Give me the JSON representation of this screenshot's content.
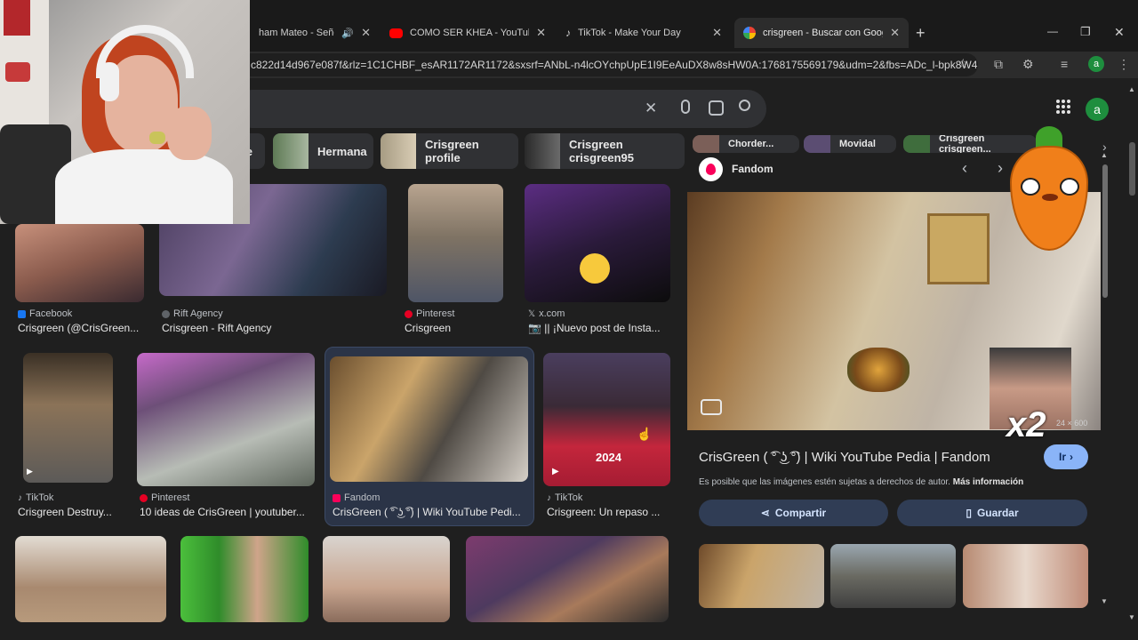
{
  "tabs": [
    {
      "title": "ham Mateo - Señorita",
      "favicon_color": "#3c3c3c",
      "has_audio": true
    },
    {
      "title": "COMO SER KHEA - YouTube",
      "favicon_color": "#ff0000"
    },
    {
      "title": "TikTok - Make Your Day",
      "favicon_color": "#111111"
    },
    {
      "title": "crisgreen - Buscar con Google",
      "favicon_color": "#4285f4",
      "active": true
    }
  ],
  "new_tab": "+",
  "window_controls": {
    "minimize": "—",
    "restore": "❐",
    "close": "✕"
  },
  "url": "c822d14d967e087f&rlz=1C1CHBF_esAR1172AR1172&sxsrf=ANbL-n4lcOYchpUpE1I9EeAuDX8w8sHW0A:1768175569179&udm=2&fbs=ADc_l-bpk8W4...",
  "profile_initial": "a",
  "chips": [
    {
      "label": "e"
    },
    {
      "label": "Hermana"
    },
    {
      "label": "Crisgreen profile"
    },
    {
      "label": "Crisgreen crisgreen95"
    },
    {
      "label": "Chorder..."
    },
    {
      "label": "Movidal"
    },
    {
      "label": "Crisgreen crisgreen..."
    }
  ],
  "results_row1": [
    {
      "source": "Facebook",
      "source_color": "#1877f2",
      "caption": "Crisgreen (@CrisGreen..."
    },
    {
      "source": "Rift Agency",
      "source_color": "#5f6368",
      "caption": "Crisgreen - Rift Agency"
    },
    {
      "source": "Pinterest",
      "source_color": "#e60023",
      "caption": "Crisgreen"
    },
    {
      "source": "x.com",
      "source_color": "#444444",
      "caption": "📷 || ¡Nuevo post de Insta..."
    }
  ],
  "results_row2": [
    {
      "source": "TikTok",
      "source_color": "#111111",
      "caption": "Crisgreen Destruy..."
    },
    {
      "source": "Pinterest",
      "source_color": "#e60023",
      "caption": "10 ideas de CrisGreen | youtuber..."
    },
    {
      "source": "Fandom",
      "source_color": "#fa005a",
      "caption": "CrisGreen ( ͡° ͜ʖ ͡°) | Wiki YouTube Pedi..."
    },
    {
      "source": "TikTok",
      "source_color": "#111111",
      "caption": "Crisgreen: Un repaso ..."
    }
  ],
  "year_overlay": "2024",
  "panel": {
    "source": "Fandom",
    "title": "CrisGreen ( ͡° ͜ʖ ͡°) | Wiki YouTube Pedia | Fandom",
    "visit": "Ir",
    "dims": "24 × 600",
    "copyright": "Es posible que las imágenes estén sujetas a derechos de autor.",
    "more_info": "Más información",
    "share": "Compartir",
    "save": "Guardar"
  },
  "sticker": {
    "multiplier": "x2"
  },
  "colors": {
    "accent": "#8ab4f8",
    "avatar": "#1e8e3e",
    "fandom": "#fa005a"
  }
}
